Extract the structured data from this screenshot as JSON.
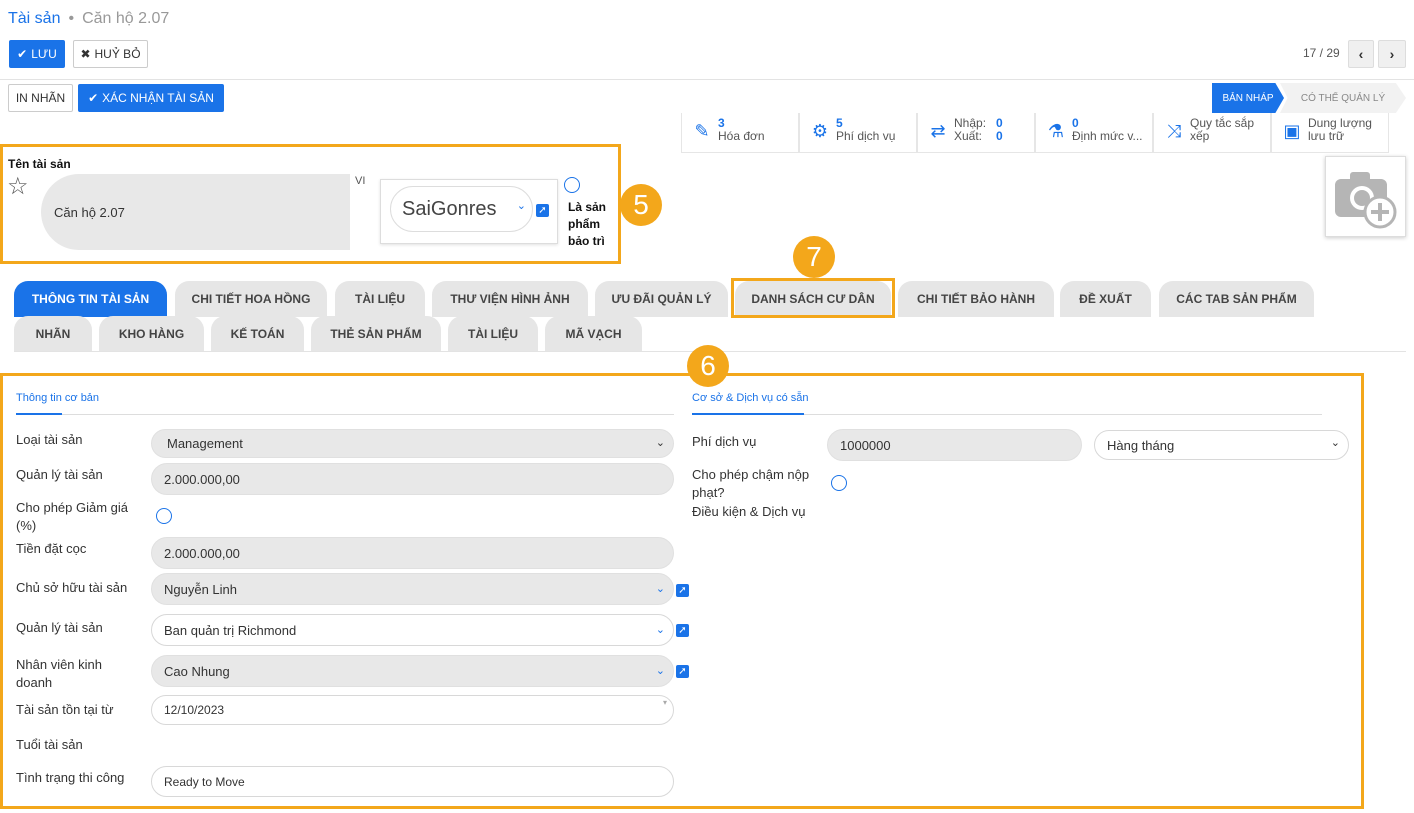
{
  "breadcrumb": {
    "root": "Tài sản",
    "separator": "•",
    "current": "Căn hộ 2.07"
  },
  "toolbar": {
    "save_label": "LƯU",
    "discard_label": "HUỶ BỎ",
    "pager": "17 / 29"
  },
  "actions": {
    "print_label": "IN NHÃN",
    "confirm_label": "XÁC NHẬN TÀI SẢN"
  },
  "status": {
    "draft": "BẢN NHÁP",
    "manageable": "CÓ THỂ QUẢN LÝ"
  },
  "stats": [
    {
      "icon": "edit-icon",
      "num": "3",
      "label": "Hóa đơn"
    },
    {
      "icon": "gears-icon",
      "num": "5",
      "label": "Phí dịch vụ"
    },
    {
      "icon": "exchange-icon",
      "in_label": "Nhập:",
      "in_val": "0",
      "out_label": "Xuất:",
      "out_val": "0"
    },
    {
      "icon": "flask-icon",
      "num": "0",
      "label": "Định mức v..."
    },
    {
      "icon": "shuffle-icon",
      "line1": "Quy tắc sắp",
      "line2": "xếp"
    },
    {
      "icon": "cubes-icon",
      "line1": "Dung lượng",
      "line2": "lưu trữ"
    }
  ],
  "title_section": {
    "label": "Tên tài sản",
    "name_value": "Căn hộ 2.07",
    "lang": "VI",
    "company": "SaiGonres",
    "maintenance_label": "Là sản phẩm bảo trì"
  },
  "badges": {
    "b5": "5",
    "b6": "6",
    "b7": "7"
  },
  "tabs_row1": [
    "THÔNG TIN TÀI SẢN",
    "CHI TIẾT HOA HỒNG",
    "TÀI LIỆU",
    "THƯ VIỆN HÌNH ẢNH",
    "ƯU ĐÃI QUẢN LÝ",
    "DANH SÁCH CƯ DÂN",
    "CHI TIẾT BẢO HÀNH",
    "ĐỀ XUẤT",
    "CÁC TAB SẢN PHẨM"
  ],
  "tabs_row2": [
    "NHÃN",
    "KHO HÀNG",
    "KẾ TOÁN",
    "THẺ SẢN PHẨM",
    "TÀI LIỆU",
    "MÃ VẠCH"
  ],
  "left": {
    "section_title": "Thông tin cơ bản",
    "type_label": "Loại tài sản",
    "type_value": "Management",
    "mgmt_label": "Quản lý tài sản",
    "mgmt_value": "2.000.000,00",
    "discount_label": "Cho phép Giảm giá (%)",
    "deposit_label": "Tiền đặt cọc",
    "deposit_value": "2.000.000,00",
    "owner_label": "Chủ sở hữu tài sản",
    "owner_value": "Nguyễn Linh",
    "manager_label": "Quản lý tài sản",
    "manager_value": "Ban quản trị Richmond",
    "sales_label": "Nhân viên kinh doanh",
    "sales_value": "Cao Nhung",
    "since_label": "Tài sản tồn tại từ",
    "since_value": "12/10/2023",
    "age_label": "Tuổi tài sản",
    "construction_label": "Tình trạng thi công",
    "construction_value": "Ready to Move"
  },
  "right": {
    "section_title": "Cơ sở & Dịch vụ có sẵn",
    "fee_label": "Phí dịch vụ",
    "fee_value": "1000000",
    "fee_period": "Hàng tháng",
    "late_label": "Cho phép chậm nộp phạt?",
    "terms_label": "Điều kiện & Dịch vụ"
  },
  "colors": {
    "accent": "#1a73e8",
    "highlight": "#f3a71b"
  }
}
